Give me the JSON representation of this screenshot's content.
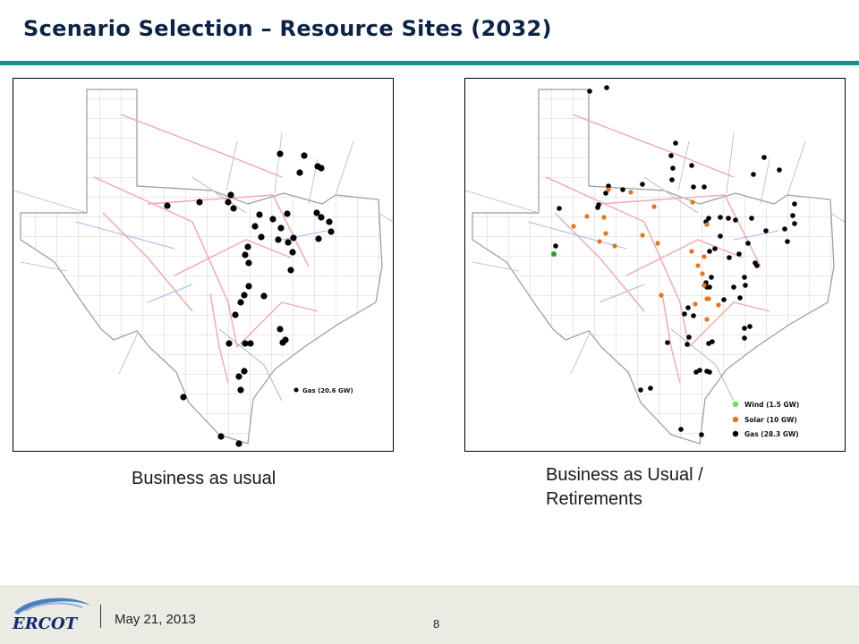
{
  "slide": {
    "title": "Scenario Selection – Resource Sites (2032)",
    "accent_color": "#12958f",
    "title_color": "#0b2345"
  },
  "maps": [
    {
      "caption": "Business as usual",
      "legend": [
        {
          "label": "Gas (20.6 GW)",
          "color": "#000000"
        }
      ]
    },
    {
      "caption": "Business as Usual / Retirements",
      "legend": [
        {
          "label": "Wind (1.5 GW)",
          "color": "#66e64d"
        },
        {
          "label": "Solar (10 GW)",
          "color": "#e8731a"
        },
        {
          "label": "Gas (28.3 GW)",
          "color": "#000000"
        }
      ]
    }
  ],
  "footer": {
    "logo_text": "ERCOT",
    "date": "May 21, 2013",
    "page_number": "8"
  }
}
